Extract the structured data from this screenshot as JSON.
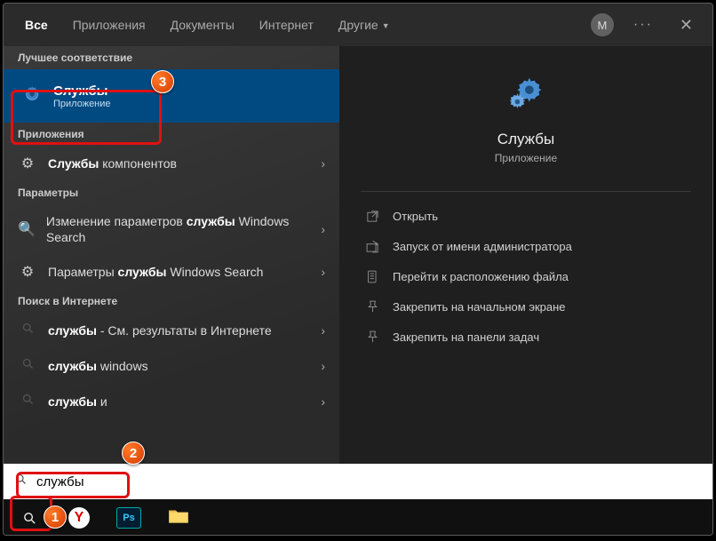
{
  "tabs": {
    "all": "Все",
    "apps": "Приложения",
    "docs": "Документы",
    "web": "Интернет",
    "more": "Другие"
  },
  "avatar_letter": "М",
  "sections": {
    "best": "Лучшее соответствие",
    "apps": "Приложения",
    "settings": "Параметры",
    "web": "Поиск в Интернете"
  },
  "best_match": {
    "title": "Службы",
    "subtitle": "Приложение"
  },
  "app_items": [
    {
      "prefix": "Службы",
      "rest": " компонентов"
    }
  ],
  "setting_items": [
    {
      "prefix": "Изменение параметров ",
      "bold": "службы",
      "suffix": " Windows Search"
    },
    {
      "prefix": "Параметры ",
      "bold": "службы",
      "suffix": " Windows Search"
    }
  ],
  "web_items": [
    {
      "bold": "службы",
      "suffix": " - См. результаты в Интернете"
    },
    {
      "bold": "службы",
      "suffix": " windows"
    },
    {
      "bold": "службы",
      "suffix": " и"
    }
  ],
  "preview": {
    "title": "Службы",
    "subtitle": "Приложение"
  },
  "actions": {
    "open": "Открыть",
    "admin": "Запуск от имени администратора",
    "location": "Перейти к расположению файла",
    "pin_start": "Закрепить на начальном экране",
    "pin_task": "Закрепить на панели задач"
  },
  "search_value": "службы",
  "badges": {
    "1": "1",
    "2": "2",
    "3": "3"
  }
}
